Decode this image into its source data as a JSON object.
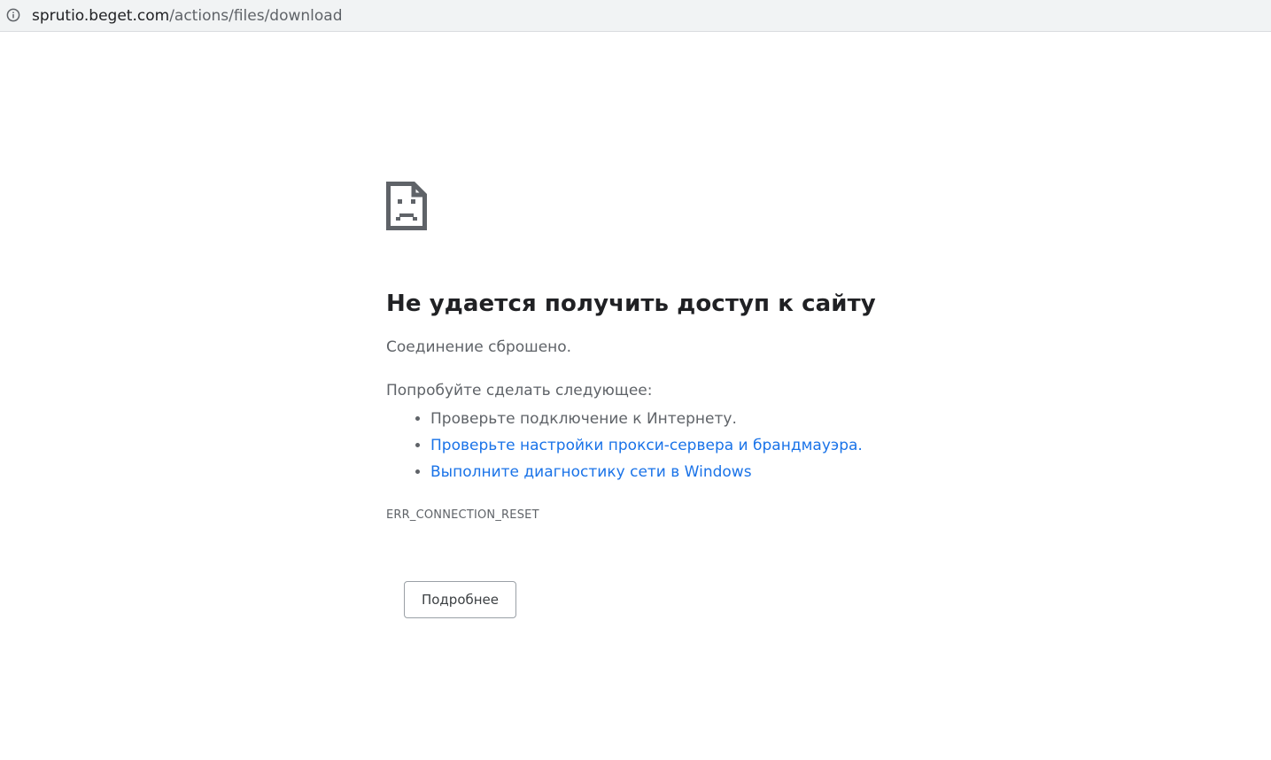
{
  "address_bar": {
    "domain": "sprutio.beget.com",
    "path": "/actions/files/download",
    "info_icon": "info-icon"
  },
  "error_page": {
    "icon": "sad-document-icon",
    "title": "Не удается получить доступ к сайту",
    "lead": "Соединение сброшено.",
    "suggestions_intro": "Попробуйте сделать следующее:",
    "suggestions": [
      {
        "text": "Проверьте подключение к Интернету.",
        "is_link": false
      },
      {
        "text": "Проверьте настройки прокси-сервера и брандмауэра.",
        "is_link": true
      },
      {
        "text": "Выполните диагностику сети в Windows",
        "is_link": true
      }
    ],
    "error_code": "ERR_CONNECTION_RESET",
    "details_button": "Подробнее"
  },
  "colors": {
    "title": "#202124",
    "body_text": "#5f6368",
    "link": "#1a73e8",
    "address_bar_bg": "#f1f3f4"
  }
}
